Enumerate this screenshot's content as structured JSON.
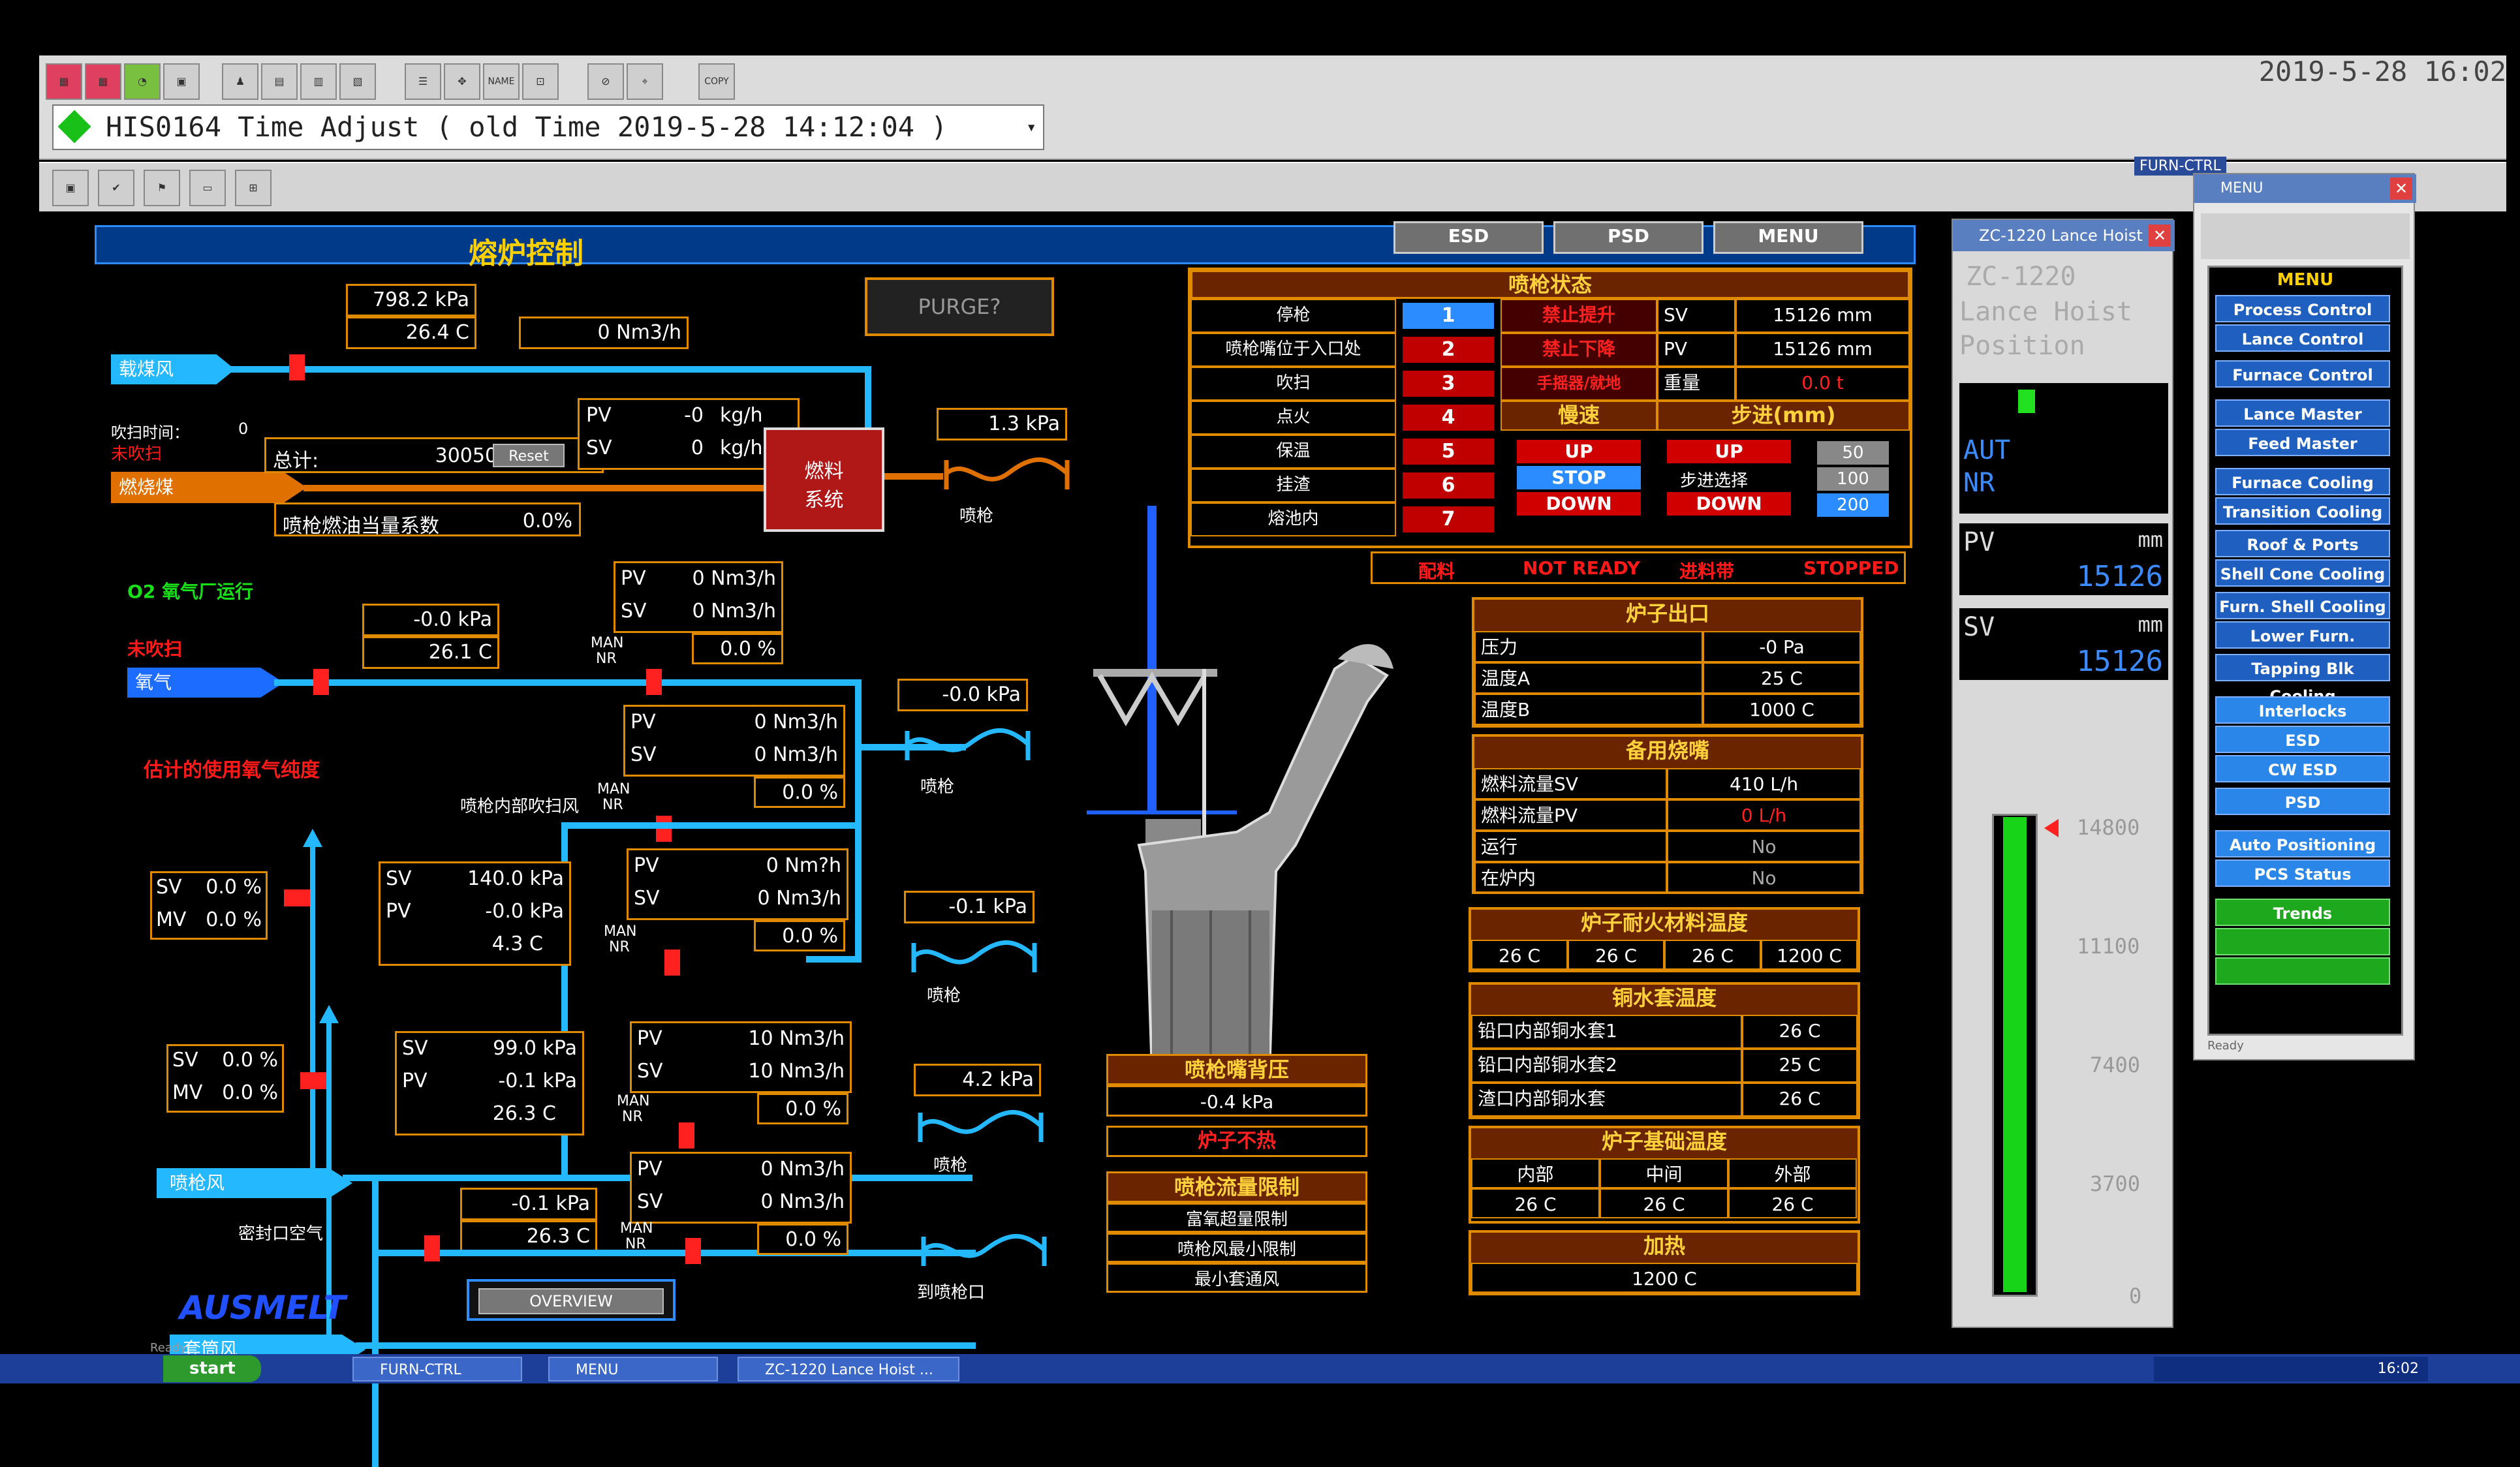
{
  "window": {
    "clock": "2019-5-28 16:02",
    "combo_text": "HIS0164  Time Adjust ( old Time 2019-5-28 14:12:04 )",
    "toolbar_name_label": "NAME",
    "toolbar_copy_label": "COPY",
    "furn_ctrl_label": "FURN-CTRL"
  },
  "main": {
    "title": "熔炉控制",
    "top_buttons": [
      "ESD",
      "PSD",
      "MENU"
    ],
    "purge_button": "PURGE?",
    "overview_button": "OVERVIEW",
    "brand": "AUSMELT",
    "coal": {
      "pressure": "798.2 kPa",
      "temp": "26.4 C",
      "flow": "0 Nm3/h",
      "pipe_label": "载煤风",
      "purge_time_label": "吹扫时间：",
      "purge_time_value": "0",
      "purge_status": "未吹扫",
      "fuel_label": "燃烧煤",
      "pv_label": "PV",
      "pv_value": "-0",
      "pv_unit": "kg/h",
      "sv_label": "SV",
      "sv_value": "0",
      "sv_unit": "kg/h",
      "total_label": "总计:",
      "total_value": "30050 kg",
      "reset_button": "Reset",
      "equiv_label": "喷枪燃油当量系数",
      "equiv_value": "0.0%",
      "fuel_system_label": "燃料\n系统",
      "lance_pressure": "1.3 kPa",
      "lance_label": "喷枪"
    },
    "oxygen": {
      "plant_status": "O2 氧气厂运行",
      "purge_status": "未吹扫",
      "pipe_label": "氧气",
      "pressure": "-0.0 kPa",
      "temp": "26.1 C",
      "pv_label": "PV",
      "pv_value": "0 Nm3/h",
      "sv_label": "SV",
      "sv_value": "0 Nm3/h",
      "pct": "0.0 %",
      "man": "MAN",
      "nr": "NR",
      "purity_label": "估计的使用氧气纯度",
      "inner_purge_label": "喷枪内部吹扫风",
      "pv2_value": "0 Nm3/h",
      "sv2_value": "0 Nm3/h",
      "pct2": "0.0 %",
      "lance_pressure": "-0.0 kPa",
      "lance_label": "喷枪"
    },
    "lance_air": {
      "sv_label": "SV",
      "sv_pct": "0.0 %",
      "mv_label": "MV",
      "mv_pct": "0.0 %",
      "pressure_sv_label": "SV",
      "pressure_sv": "140.0 kPa",
      "pressure_pv_label": "PV",
      "pressure_pv": "-0.0 kPa",
      "temp": "4.3 C",
      "pv_label": "PV",
      "pv_value": "0 Nm?h",
      "sv_label2": "SV",
      "sv_value": "0 Nm3/h",
      "pct": "0.0 %",
      "pipe_label": "喷枪风",
      "lance_pressure": "-0.1 kPa",
      "lance_label": "喷枪"
    },
    "sleeve_air": {
      "sv_label": "SV",
      "sv_pct": "0.0 %",
      "mv_label": "MV",
      "mv_pct": "0.0 %",
      "pressure_sv": "99.0 kPa",
      "pressure_pv": "-0.1 kPa",
      "temp": "26.3 C",
      "pv_value": "10 Nm3/h",
      "sv_value": "10 Nm3/h",
      "pct": "0.0 %",
      "pipe_label": "套筒风",
      "lance_pressure": "4.2 kPa",
      "lance_label": "喷枪"
    },
    "seal_air": {
      "label": "密封口空气",
      "pressure": "-0.1 kPa",
      "temp": "26.3 C",
      "pv_value": "0 Nm3/h",
      "sv_value": "0 Nm3/h",
      "pct": "0.0 %",
      "dest_label": "到喷枪口"
    },
    "lance_status": {
      "header": "喷枪状态",
      "rows": [
        {
          "label": "停枪",
          "num": "1"
        },
        {
          "label": "喷枪嘴位于入口处",
          "num": "2"
        },
        {
          "label": "吹扫",
          "num": "3"
        },
        {
          "label": "点火",
          "num": "4"
        },
        {
          "label": "保温",
          "num": "5"
        },
        {
          "label": "挂渣",
          "num": "6"
        },
        {
          "label": "熔池内",
          "num": "7"
        }
      ],
      "interlock1": "禁止提升",
      "interlock2": "禁止下降",
      "interlock3": "手摇器/就地",
      "sv_label": "SV",
      "sv_value": "15126 mm",
      "pv_label": "PV",
      "pv_value": "15126 mm",
      "weight_label": "重量",
      "weight_value": "0.0 t",
      "speed_label": "慢速",
      "step_label": "步进(mm)",
      "up": "UP",
      "stop": "STOP",
      "down": "DOWN",
      "step_up": "UP",
      "step_select": "步进选择",
      "step_down": "DOWN",
      "steps": [
        "50",
        "100",
        "200"
      ],
      "feed_label": "配料",
      "not_ready": "NOT READY",
      "conveyor_label": "进料带",
      "stopped": "STOPPED"
    },
    "furnace_outlet": {
      "header": "炉子出口",
      "rows": [
        {
          "label": "压力",
          "value": "-0 Pa"
        },
        {
          "label": "温度A",
          "value": "25 C"
        },
        {
          "label": "温度B",
          "value": "1000 C"
        }
      ]
    },
    "standby_burner": {
      "header": "备用烧嘴",
      "rows": [
        {
          "label": "燃料流量SV",
          "value": "410 L/h"
        },
        {
          "label": "燃料流量PV",
          "value": "0 L/h"
        },
        {
          "label": "运行",
          "value": "No"
        },
        {
          "label": "在炉内",
          "value": "No"
        }
      ]
    },
    "refractory_temp": {
      "header": "炉子耐火材料温度",
      "values": [
        "26 C",
        "26 C",
        "26 C",
        "1200 C"
      ]
    },
    "copper_jacket": {
      "header": "铜水套温度",
      "rows": [
        {
          "label": "铅口内部铜水套1",
          "value": "26 C"
        },
        {
          "label": "铅口内部铜水套2",
          "value": "25 C"
        },
        {
          "label": "渣口内部铜水套",
          "value": "26 C"
        }
      ]
    },
    "foundation_temp": {
      "header": "炉子基础温度",
      "labels": [
        "内部",
        "中间",
        "外部"
      ],
      "values": [
        "26 C",
        "26 C",
        "26 C"
      ]
    },
    "heating": {
      "header": "加热",
      "value": "1200 C"
    },
    "nozzle_back_pressure": {
      "header": "喷枪嘴背压",
      "value": "-0.4 kPa"
    },
    "furnace_alarm": "炉子不热",
    "flow_limit": {
      "header": "喷枪流量限制",
      "items": [
        "富氧超量限制",
        "喷枪风最小限制",
        "最小套通风"
      ]
    }
  },
  "zc_panel": {
    "window_title": "ZC-1220 Lance Hoist ...",
    "line1": "ZC-1220",
    "line2": "Lance Hoist",
    "line3": "Position",
    "mode1": "AUT",
    "mode2": "NR",
    "pv_label": "PV",
    "pv_unit": "mm",
    "pv_value": "15126",
    "sv_label": "SV",
    "sv_unit": "mm",
    "sv_value": "15126",
    "scale": [
      "14800",
      "11100",
      "7400",
      "3700",
      "0"
    ],
    "level_fraction": 1.0,
    "bar_color": "#18d418"
  },
  "menu_panel": {
    "window_title": "MENU",
    "header": "MENU",
    "status": "Ready",
    "items": [
      "Process Control O/V",
      "Lance Control",
      "Furnace Control",
      "Lance Master",
      "Feed Master",
      "Furnace Cooling",
      "Transition Cooling",
      "Roof & Ports Cooling",
      "Shell Cone Cooling",
      "Furn. Shell Cooling",
      "Lower Furn. Cooling",
      "Tapping Blk Cooling",
      "Interlocks",
      "ESD",
      "CW ESD",
      "PSD",
      "Auto Positioning",
      "PCS Status",
      "Trends",
      "",
      ""
    ]
  },
  "taskbar": {
    "start": "start",
    "tasks": [
      "FURN-CTRL",
      "MENU",
      "ZC-1220 Lance Hoist ..."
    ],
    "time": "16:02"
  },
  "statusbar": "Ready",
  "colors": {
    "pipe": "#24b8ff",
    "valve": "#ff2020",
    "orange": "#e08a00",
    "title_yellow": "#ffd000",
    "panel_brown": "#6b2400"
  }
}
